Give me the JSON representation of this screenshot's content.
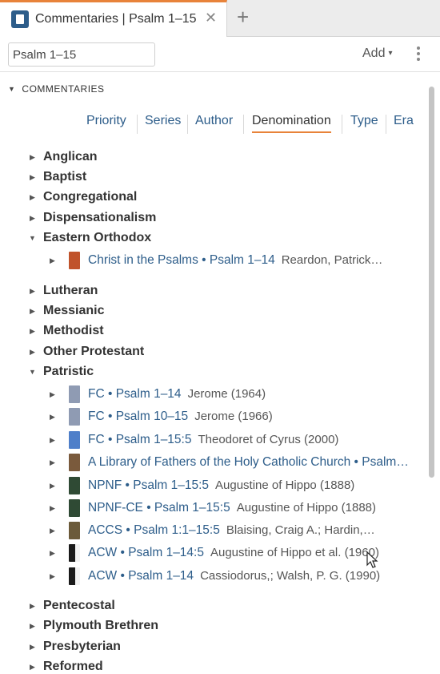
{
  "tab": {
    "title": "Commentaries | Psalm 1–15",
    "close_glyph": "✕",
    "add_glyph": "+"
  },
  "toolbar": {
    "reference_value": "Psalm 1–15",
    "add_label": "Add",
    "add_caret": "▾"
  },
  "section": {
    "title": "COMMENTARIES",
    "expander": "▼"
  },
  "sort_tabs": [
    {
      "label": "Priority",
      "active": false
    },
    {
      "label": "Series",
      "active": false
    },
    {
      "label": "Author",
      "active": false
    },
    {
      "label": "Denomination",
      "active": true
    },
    {
      "label": "Type",
      "active": false
    },
    {
      "label": "Era",
      "active": false
    }
  ],
  "groups": {
    "anglican": {
      "label": "Anglican",
      "expanded": false
    },
    "baptist": {
      "label": "Baptist",
      "expanded": false
    },
    "congregational": {
      "label": "Congregational",
      "expanded": false
    },
    "dispensationalism": {
      "label": "Dispensationalism",
      "expanded": false
    },
    "eastern_orthodox": {
      "label": "Eastern Orthodox",
      "expanded": true,
      "items": [
        {
          "title": "Christ in the Psalms • Psalm 1–14",
          "author": "Reardon, Patrick…",
          "cover_color": "#c0532b"
        }
      ]
    },
    "lutheran": {
      "label": "Lutheran",
      "expanded": false
    },
    "messianic": {
      "label": "Messianic",
      "expanded": false
    },
    "methodist": {
      "label": "Methodist",
      "expanded": false
    },
    "other_protestant": {
      "label": "Other Protestant",
      "expanded": false
    },
    "patristic": {
      "label": "Patristic",
      "expanded": true,
      "items": [
        {
          "title": "FC • Psalm 1–14",
          "author": "Jerome (1964)",
          "cover_color": "#8f9bb3"
        },
        {
          "title": "FC • Psalm 10–15",
          "author": "Jerome (1966)",
          "cover_color": "#8f9bb3"
        },
        {
          "title": "FC • Psalm 1–15:5",
          "author": "Theodoret of Cyrus (2000)",
          "cover_color": "#4f7fc9"
        },
        {
          "title": "A Library of Fathers of the Holy Catholic Church • Psalm…",
          "author": "",
          "cover_color": "#7a5a3c"
        },
        {
          "title": "NPNF • Psalm 1–15:5",
          "author": "Augustine of Hippo (1888)",
          "cover_color": "#2f4a34"
        },
        {
          "title": "NPNF-CE • Psalm 1–15:5",
          "author": "Augustine of Hippo (1888)",
          "cover_color": "#2f4a34"
        },
        {
          "title": "ACCS • Psalm 1:1–15:5",
          "author": "Blaising, Craig A.; Hardin,…",
          "cover_color": "#6b5a3a"
        },
        {
          "title": "ACW • Psalm 1–14:5",
          "author": "Augustine of Hippo et al. (1960)",
          "cover_color": "#1a1a1a"
        },
        {
          "title": "ACW • Psalm 1–14",
          "author": "Cassiodorus,; Walsh, P. G. (1990)",
          "cover_color": "#1a1a1a"
        }
      ]
    },
    "pentecostal": {
      "label": "Pentecostal",
      "expanded": false
    },
    "plymouth_brethren": {
      "label": "Plymouth Brethren",
      "expanded": false
    },
    "presbyterian": {
      "label": "Presbyterian",
      "expanded": false
    },
    "reformed": {
      "label": "Reformed",
      "expanded": false
    }
  },
  "icons": {
    "collapsed_arrow": "▶",
    "expanded_arrow": "▼"
  },
  "colors": {
    "accent": "#e8833a",
    "link": "#2d5d8a"
  }
}
